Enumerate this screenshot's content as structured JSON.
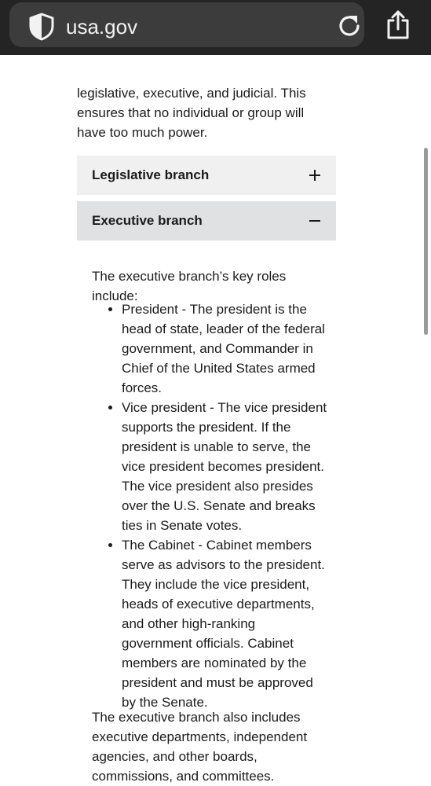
{
  "browser": {
    "url": "usa.gov"
  },
  "intro_text": "legislative, executive, and judicial. This ensures that no individual or group will have too much power.",
  "accordion": [
    {
      "label": "Legislative branch",
      "state": "collapsed",
      "icon": "plus-icon"
    },
    {
      "label": "Executive branch",
      "state": "expanded",
      "icon": "minus-icon"
    }
  ],
  "executive_panel": {
    "lead": "The executive branch’s key roles include:",
    "roles": [
      "President - The president is the head of state, leader of the federal government, and Commander in Chief of the United States armed forces.",
      "Vice president - The vice president supports the president. If the president is unable to serve, the vice president becomes president. The vice president also presides over the U.S. Senate and breaks ties in Senate votes.",
      "The Cabinet - Cabinet members serve as advisors to the president. They include the vice president, heads of executive departments, and other high-ranking government officials. Cabinet members are nominated by the president and must be approved by the Senate."
    ],
    "tail": "The executive branch also includes executive departments, independent agencies, and other boards, commissions, and committees."
  },
  "colors": {
    "browser_bar": "#242424",
    "address_pill": "#3c3c3c",
    "accordion_collapsed": "#f0f0f0",
    "accordion_expanded": "#dfe1e2",
    "text": "#1b1b1b"
  }
}
